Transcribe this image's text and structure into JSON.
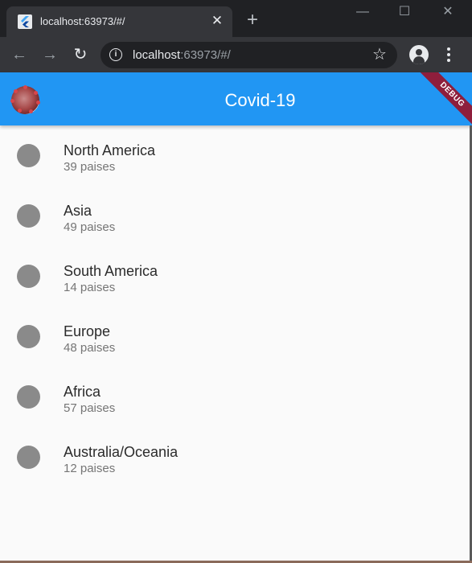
{
  "browser": {
    "tab_title": "localhost:63973/#/",
    "tab_close": "✕",
    "new_tab": "+",
    "url_host": "localhost",
    "url_rest": ":63973/#/"
  },
  "app": {
    "title": "Covid-19",
    "debug_label": "DEBUG",
    "primary_color": "#2196f3",
    "banner_color": "#8e1e3c"
  },
  "continents": [
    {
      "name": "North America",
      "countries": "39 paises"
    },
    {
      "name": "Asia",
      "countries": "49 paises"
    },
    {
      "name": "South America",
      "countries": "14 paises"
    },
    {
      "name": "Europe",
      "countries": "48 paises"
    },
    {
      "name": "Africa",
      "countries": "57 paises"
    },
    {
      "name": "Australia/Oceania",
      "countries": "12 paises"
    }
  ]
}
